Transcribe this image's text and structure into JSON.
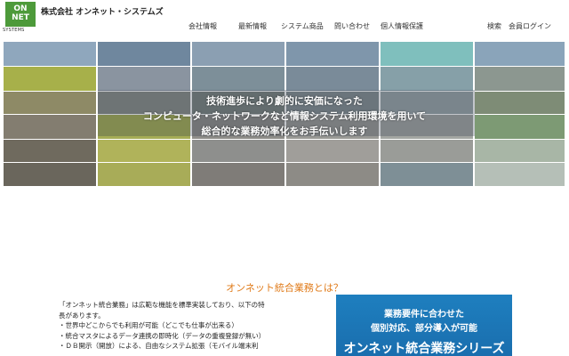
{
  "header": {
    "logo_text": "ON NET",
    "logo_subtext": "SYSTEMS",
    "company_name": "株式会社 オンネット・システムズ"
  },
  "nav": {
    "company": "会社情報",
    "news": "最新情報",
    "products": "システム商品",
    "contact": "問い合わせ",
    "privacy": "個人情報保護",
    "search": "検索",
    "login": "会員ログイン"
  },
  "hero": {
    "line1": "技術進歩により劇的に安価になった",
    "line2": "コンピュータ・ネットワークなど情報システム利用環境を用いて",
    "line3": "総合的な業務効率化をお手伝いします"
  },
  "section": {
    "title": "オンネット統合業務とは？",
    "intro": [
      "「オンネット統合業務」は広範な機能を標準実装しており、以下の特",
      "長があります。",
      "・世界中どこからでも利用が可能（どこでも仕事が出来る）",
      "・統合マスタによるデータ連携の即時化（データの重複登録が無い）",
      "・ＤＢ開示（開放）による、自由なシステム拡張（モバイル端末利"
    ]
  },
  "promo": {
    "line1": "業務要件に合わせた",
    "line2": "個別対応、部分導入が可能",
    "line3": "オンネット統合業務シリーズ"
  },
  "colors": {
    "brand_green": "#4d9a3a",
    "accent_orange": "#e07b1a",
    "promo_blue": "#1a6eae"
  }
}
